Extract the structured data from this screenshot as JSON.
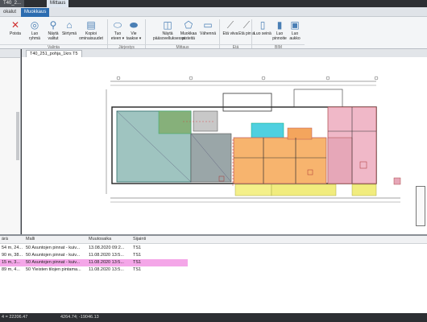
{
  "window": {
    "doc_tab": "T40_2...",
    "context_tab": "Mittaus"
  },
  "ribbon_tabs": [
    {
      "label": "okalut",
      "active": false
    },
    {
      "label": "Muokkaus",
      "active": true
    }
  ],
  "ribbon_buttons": [
    {
      "id": "poista",
      "label": "Poista",
      "icon": "delete-x-icon"
    },
    {
      "id": "luo-ryhma",
      "label": "Luo ryhmä",
      "icon": "group-icon"
    },
    {
      "id": "nayta-valitut",
      "label": "Näytä valitut",
      "icon": "show-selected-icon"
    },
    {
      "id": "siirtyma",
      "label": "Siirtymä",
      "icon": "move-icon"
    },
    {
      "id": "kopioi-ominaisuudet",
      "label": "Kopioi ominaisuudet",
      "icon": "copy-properties-icon"
    },
    {
      "id": "tuo-eteen",
      "label": "Tuo eteen ▾",
      "icon": "bring-front-icon"
    },
    {
      "id": "vie-taakse",
      "label": "Vie taakse ▾",
      "icon": "send-back-icon"
    },
    {
      "id": "nayta-paasvelluksessa",
      "label": "Näytä pääsovelluksessa",
      "icon": "show-in-app-icon"
    },
    {
      "id": "muokkaa",
      "label": "Muokkaa pisteitä",
      "icon": "edit-points-icon"
    },
    {
      "id": "vahenna",
      "label": "Vähennä",
      "icon": "subtract-icon"
    },
    {
      "id": "eta-viiva",
      "label": "Etä viiva",
      "icon": "distance-line-icon"
    },
    {
      "id": "eta-pinta",
      "label": "Etä pinta",
      "icon": "distance-area-icon"
    },
    {
      "id": "luo-seina",
      "label": "Luo seinä",
      "icon": "wall-icon"
    },
    {
      "id": "luo-pinnoite",
      "label": "Luo pinnoite",
      "icon": "coating-icon"
    },
    {
      "id": "luo-aukko",
      "label": "Luo aukko",
      "icon": "opening-icon"
    }
  ],
  "ribbon_groups": [
    "Valinta",
    "Järjestys",
    "Mittaus",
    "Etä",
    "BIM"
  ],
  "left_panel": {
    "title": ""
  },
  "drawing_tab": {
    "label": "T40_251_pohja_1krs T5"
  },
  "table": {
    "columns": [
      "ärä",
      "Malli",
      "Muutosaika",
      "Sijainti"
    ],
    "rows": [
      {
        "qty": "54 m, 24...",
        "model": "50 Asuntojen pinnat - kuiv...",
        "time": "13.08.2020 09:2...",
        "loc": "TS1",
        "selected": false
      },
      {
        "qty": "90 m, 38...",
        "model": "50 Asuntojen pinnat - kuiv...",
        "time": "11.08.2020 13:5...",
        "loc": "TS1",
        "selected": false
      },
      {
        "qty": "15 m, 3...",
        "model": "50 Asuntojen pinnat - kuiv...",
        "time": "11.08.2020 13:5...",
        "loc": "TS1",
        "selected": true
      },
      {
        "qty": "89 m, 4...",
        "model": "50 Yleisten tilojen pintama...",
        "time": "11.08.2020 13:5...",
        "loc": "TS1",
        "selected": false
      }
    ]
  },
  "status": {
    "left": "4 = 22206.47",
    "coords": "4264.74; -19046.13"
  },
  "colors": {
    "accent": "#2b6cb0",
    "selection": "#f4a6e8"
  }
}
